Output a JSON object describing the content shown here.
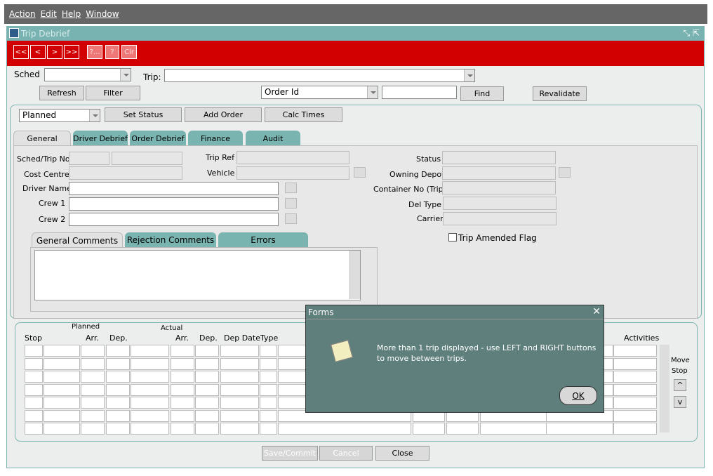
{
  "menu": [
    "Action",
    "Edit",
    "Help",
    "Window"
  ],
  "window": {
    "title": "Trip Debrief"
  },
  "nav_buttons": [
    "<<",
    "<",
    ">",
    ">>",
    "?...",
    "?",
    "Clr"
  ],
  "top": {
    "sched_label": "Sched",
    "trip_label": "Trip:",
    "refresh": "Refresh",
    "filter": "Filter",
    "order_id": "Order Id",
    "find": "Find",
    "revalidate": "Revalidate"
  },
  "status_bar": {
    "status_value": "Planned",
    "set_status": "Set Status",
    "add_order": "Add Order",
    "calc_times": "Calc Times"
  },
  "tabs": [
    "General",
    "Driver Debrief",
    "Order Debrief",
    "Finance",
    "Audit"
  ],
  "general": {
    "sched_trip_no": "Sched/Trip No",
    "trip_ref": "Trip Ref",
    "status": "Status",
    "cost_centre": "Cost Centre",
    "vehicle": "Vehicle",
    "owning_depot": "Owning Depot",
    "driver_name": "Driver Name",
    "container_no": "Container No (Trip)",
    "crew1": "Crew 1",
    "del_type": "Del Type",
    "crew2": "Crew 2",
    "carrier": "Carrier",
    "trip_amended": "Trip Amended Flag"
  },
  "comment_tabs": [
    "General Comments",
    "Rejection Comments",
    "Errors"
  ],
  "stops": {
    "planned": "Planned",
    "actual": "Actual",
    "stop": "Stop",
    "arr": "Arr.",
    "dep": "Dep.",
    "arr2": "Arr.",
    "dep2": "Dep.",
    "dep_date": "Dep Date",
    "type": "Type",
    "activities": "Activities",
    "move": "Move",
    "stop2": "Stop",
    "up": "^",
    "down": "v"
  },
  "footer": {
    "save": "Save/Commit",
    "cancel": "Cancel",
    "close": "Close"
  },
  "dialog": {
    "title": "Forms",
    "message": "More than 1 trip displayed - use LEFT and RIGHT buttons to move between trips.",
    "ok": "OK"
  }
}
